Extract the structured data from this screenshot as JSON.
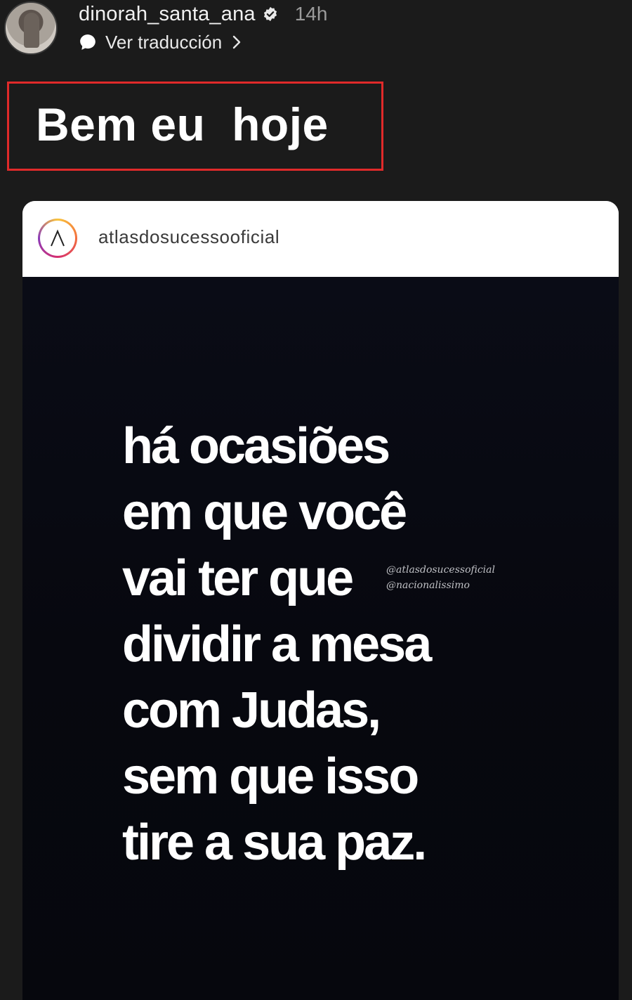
{
  "story": {
    "username": "dinorah_santa_ana",
    "time": "14h",
    "translate_label": "Ver traducción",
    "caption": "Bem eu  hoje"
  },
  "post": {
    "account": "atlasdosucessooficial",
    "quote_lines": [
      "há ocasiões",
      "em que você",
      "vai ter que",
      "dividir a mesa",
      "com Judas,",
      "sem que isso",
      "tire a sua paz."
    ],
    "watermark": [
      "@atlasdosucessoficial",
      "@nacionalissimo"
    ]
  },
  "colors": {
    "background": "#1b1b1b",
    "highlight_border": "#e02a2a",
    "post_image_bg": "#0a0c16",
    "text_primary": "#ffffff",
    "text_secondary": "#9b9b9b"
  },
  "icons": {
    "verified": "verified-badge-icon",
    "translate": "chat-bubble-icon",
    "chevron": "chevron-right-icon",
    "post_avatar": "lambda-logo-icon"
  }
}
